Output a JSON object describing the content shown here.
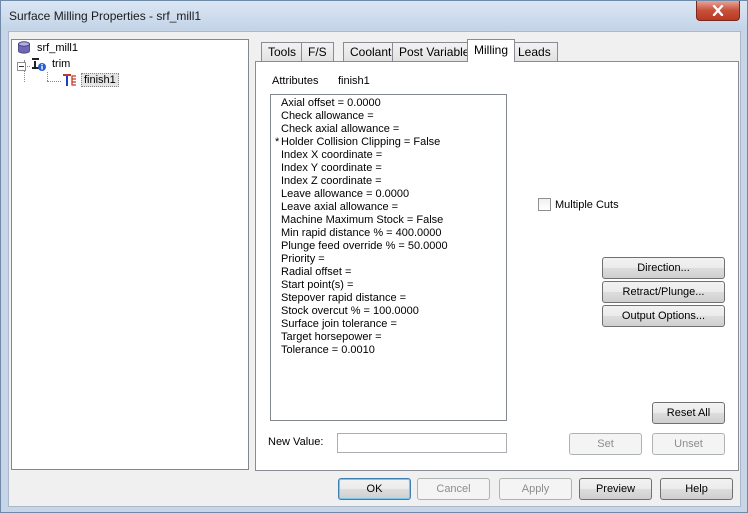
{
  "window": {
    "title": "Surface Milling Properties - srf_mill1",
    "close_icon": "close-icon"
  },
  "tree": {
    "root": {
      "label": "srf_mill1",
      "icon": "database-icon"
    },
    "child": {
      "label": "trim",
      "icon": "info-stack-icon"
    },
    "leaf": {
      "label": "finish1",
      "icon": "tool-path-icon"
    }
  },
  "tabs": [
    {
      "label": "Tools"
    },
    {
      "label": "F/S"
    },
    {
      "label": "Coolant"
    },
    {
      "label": "Post Variables"
    },
    {
      "label": "Milling"
    },
    {
      "label": "Leads"
    }
  ],
  "active_tab": "Milling",
  "panel": {
    "attributes_label": "Attributes",
    "attributes_target": "finish1",
    "attributes": [
      {
        "mark": "",
        "text": "Axial offset = 0.0000"
      },
      {
        "mark": "",
        "text": "Check allowance ="
      },
      {
        "mark": "",
        "text": "Check axial allowance ="
      },
      {
        "mark": "*",
        "text": "Holder Collision Clipping = False"
      },
      {
        "mark": "",
        "text": "Index X coordinate ="
      },
      {
        "mark": "",
        "text": "Index Y coordinate ="
      },
      {
        "mark": "",
        "text": "Index Z coordinate ="
      },
      {
        "mark": "",
        "text": "Leave allowance = 0.0000"
      },
      {
        "mark": "",
        "text": "Leave axial allowance ="
      },
      {
        "mark": "",
        "text": "Machine Maximum Stock = False"
      },
      {
        "mark": "",
        "text": "Min rapid distance % = 400.0000"
      },
      {
        "mark": "",
        "text": "Plunge feed override % = 50.0000"
      },
      {
        "mark": "",
        "text": "Priority ="
      },
      {
        "mark": "",
        "text": "Radial offset ="
      },
      {
        "mark": "",
        "text": "Start point(s) ="
      },
      {
        "mark": "",
        "text": "Stepover rapid distance ="
      },
      {
        "mark": "",
        "text": "Stock overcut % = 100.0000"
      },
      {
        "mark": "",
        "text": "Surface join tolerance ="
      },
      {
        "mark": "",
        "text": "Target horsepower ="
      },
      {
        "mark": "",
        "text": "Tolerance = 0.0010"
      }
    ],
    "multiple_cuts_label": "Multiple Cuts",
    "multiple_cuts_checked": false,
    "direction_label": "Direction...",
    "retract_label": "Retract/Plunge...",
    "output_label": "Output Options...",
    "reset_label": "Reset All",
    "new_value_label": "New Value:",
    "new_value": "",
    "set_label": "Set",
    "unset_label": "Unset"
  },
  "footer": {
    "ok": "OK",
    "cancel": "Cancel",
    "apply": "Apply",
    "preview": "Preview",
    "help": "Help"
  },
  "colors": {
    "frame": "#c7d5e6",
    "close": "#c7503b"
  }
}
